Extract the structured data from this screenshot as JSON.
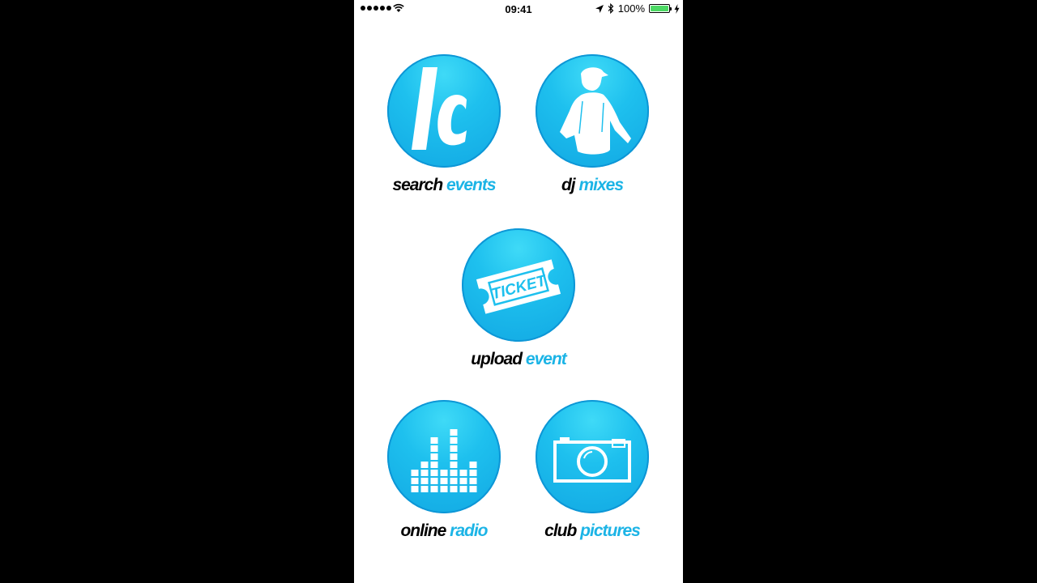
{
  "status_bar": {
    "time": "09:41",
    "battery_percent": "100%",
    "battery_level": 1.0,
    "battery_color": "#4cd964"
  },
  "theme": {
    "accent": "#1cb4e6",
    "circle_base": "#12a8e3",
    "background": "#ffffff"
  },
  "menu": {
    "search_events": {
      "first": "search",
      "second": "events",
      "icon": "lc-logo-icon"
    },
    "dj_mixes": {
      "first": "dj",
      "second": "mixes",
      "icon": "dj-silhouette-icon"
    },
    "upload_event": {
      "first": "upload",
      "second": "event",
      "icon": "ticket-icon",
      "icon_text": "TICKET"
    },
    "online_radio": {
      "first": "online",
      "second": "radio",
      "icon": "equalizer-icon"
    },
    "club_pictures": {
      "first": "club",
      "second": "pictures",
      "icon": "camera-icon"
    }
  }
}
